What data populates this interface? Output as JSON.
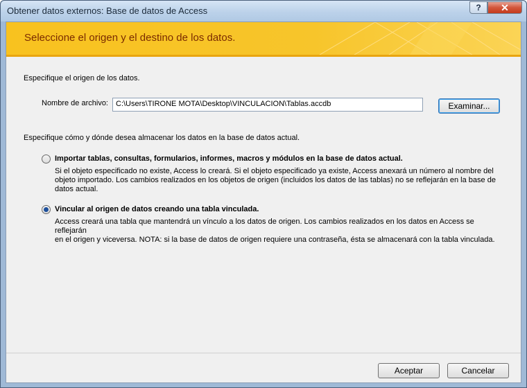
{
  "window": {
    "title": "Obtener datos externos: Base de datos de Access",
    "help_button": "?",
    "close_button": "✕"
  },
  "banner": {
    "text": "Seleccione el origen y el destino de los datos."
  },
  "source": {
    "heading": "Especifique el origen de los datos.",
    "filename_label": "Nombre de archivo:",
    "filename_value": "C:\\Users\\TIRONE MOTA\\Desktop\\VINCULACION\\Tablas.accdb",
    "browse_button": "Examinar..."
  },
  "storage": {
    "heading": "Especifique cómo y dónde desea almacenar los datos en la base de datos actual.",
    "options": [
      {
        "title": "Importar tablas, consultas, formularios, informes, macros y módulos en la base de datos actual.",
        "desc_lines": [
          "Si el objeto especificado no existe, Access lo creará. Si el objeto especificado ya existe, Access anexará un número al nombre del",
          "objeto importado. Los cambios realizados en los objetos de origen (incluidos los datos de las tablas) no se reflejarán en la base de",
          "datos actual."
        ],
        "selected": false
      },
      {
        "title": "Vincular al origen de datos creando una tabla vinculada.",
        "desc_lines": [
          "Access creará una tabla que mantendrá un vínculo a los datos de origen. Los cambios realizados en los datos en Access se reflejarán",
          "en el origen y viceversa. NOTA: si la base de datos de origen requiere una contraseña, ésta se almacenará con la tabla vinculada."
        ],
        "selected": true
      }
    ]
  },
  "footer": {
    "ok_button": "Aceptar",
    "cancel_button": "Cancelar"
  }
}
